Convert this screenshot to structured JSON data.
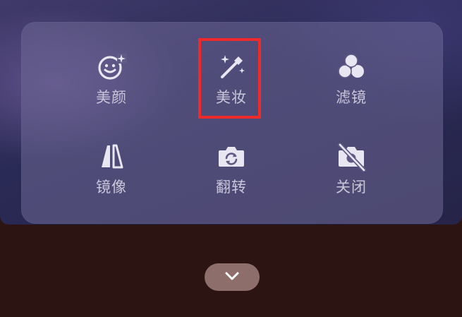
{
  "effects_panel": {
    "items": [
      {
        "label": "美颜",
        "icon": "smile-sparkle-icon"
      },
      {
        "label": "美妆",
        "icon": "magic-wand-icon"
      },
      {
        "label": "滤镜",
        "icon": "filter-circles-icon"
      },
      {
        "label": "镜像",
        "icon": "mirror-icon"
      },
      {
        "label": "翻转",
        "icon": "camera-flip-icon"
      },
      {
        "label": "关闭",
        "icon": "camera-off-icon"
      }
    ]
  },
  "collapse_button": {
    "icon": "chevron-down-icon"
  },
  "colors": {
    "highlight": "#ee2a2a",
    "icon": "#e8e6f0",
    "label": "#c9c6da",
    "panel": "#6e6896",
    "bottom_bar": "#2c1412",
    "collapse_button": "#8d6e6a"
  }
}
